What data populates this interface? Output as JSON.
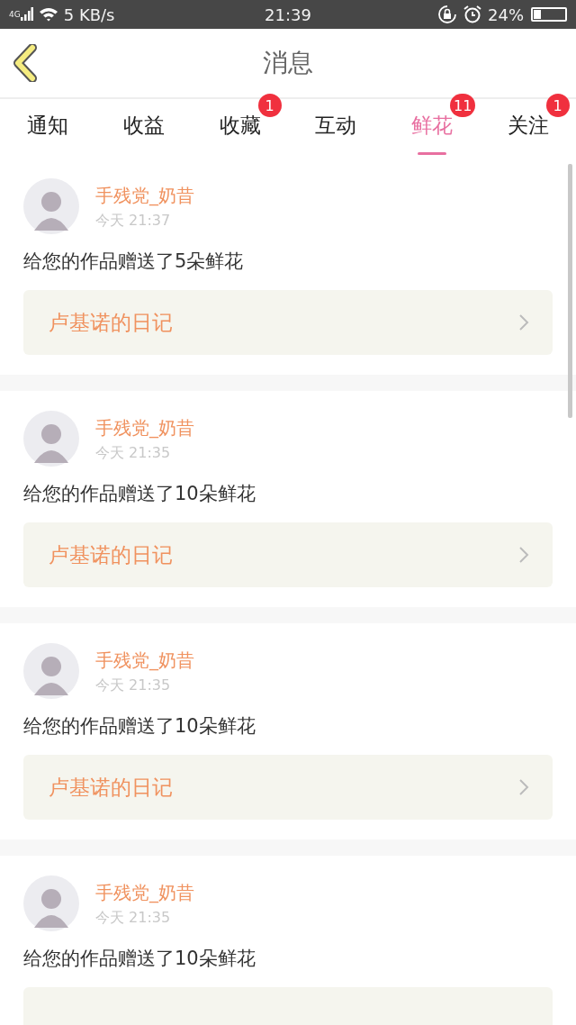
{
  "status_bar": {
    "network": "4G",
    "speed": "5 KB/s",
    "time": "21:39",
    "battery": "24%"
  },
  "header": {
    "title": "消息"
  },
  "tabs": [
    {
      "label": "通知",
      "selected": false
    },
    {
      "label": "收益",
      "selected": false
    },
    {
      "label": "收藏",
      "selected": false,
      "badge": "1"
    },
    {
      "label": "互动",
      "selected": false
    },
    {
      "label": "鲜花",
      "selected": true,
      "badge": "11"
    },
    {
      "label": "关注",
      "selected": false,
      "badge": "1"
    }
  ],
  "messages": [
    {
      "user": "手残党_奶昔",
      "time": "今天 21:37",
      "text": "给您的作品赠送了5朵鲜花",
      "work": "卢基诺的日记"
    },
    {
      "user": "手残党_奶昔",
      "time": "今天 21:35",
      "text": "给您的作品赠送了10朵鲜花",
      "work": "卢基诺的日记"
    },
    {
      "user": "手残党_奶昔",
      "time": "今天 21:35",
      "text": "给您的作品赠送了10朵鲜花",
      "work": "卢基诺的日记"
    },
    {
      "user": "手残党_奶昔",
      "time": "今天 21:35",
      "text": "给您的作品赠送了10朵鲜花"
    }
  ]
}
